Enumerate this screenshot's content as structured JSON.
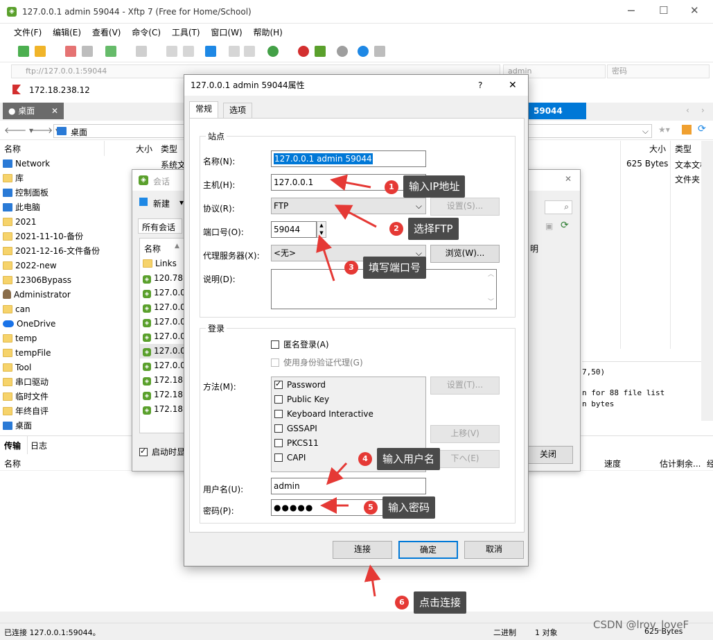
{
  "window": {
    "title": "127.0.0.1 admin 59044 - Xftp 7 (Free for Home/School)"
  },
  "menu": [
    "文件(F)",
    "编辑(E)",
    "查看(V)",
    "命令(C)",
    "工具(T)",
    "窗口(W)",
    "帮助(H)"
  ],
  "address": {
    "url": "ftp://127.0.0.1:59044",
    "user_placeholder": "admin",
    "pass_placeholder": "密码",
    "host": "172.18.238.12"
  },
  "tabs": {
    "left": "桌面",
    "right": "59044"
  },
  "nav": {
    "path": "桌面"
  },
  "left_pane": {
    "headers": {
      "name": "名称",
      "size": "大小",
      "type": "类型"
    },
    "first_type": "系统文",
    "items": [
      "Network",
      "库",
      "控制面板",
      "此电脑",
      "2021",
      "2021-11-10-备份",
      "2021-12-16-文件备份",
      "2022-new",
      "12306Bypass",
      "Administrator",
      "can",
      "OneDrive",
      "temp",
      "tempFile",
      "Tool",
      "串口驱动",
      "临时文件",
      "年终自评",
      "桌面"
    ]
  },
  "right_pane": {
    "headers": {
      "size": "大小",
      "type": "类型"
    },
    "row1": {
      "size": "625 Bytes",
      "type": "文本文档"
    },
    "row2": {
      "type": "文件夹"
    },
    "log": [
      "7,50)",
      "n for  88 file list",
      "n bytes"
    ],
    "col_partial": "明"
  },
  "transfer": {
    "tabs": [
      "传输",
      "日志"
    ],
    "headers": {
      "name": "名称",
      "speed": "速度",
      "eta": "估计剩余...",
      "last": "经"
    }
  },
  "status": {
    "left": "已连接 127.0.0.1:59044。",
    "mode": "二进制",
    "objects": "1 对象",
    "size": "625 Bytes",
    "watermark": "CSDN @lrov_loveF"
  },
  "session": {
    "title": "会话",
    "new_btn": "新建",
    "all_sessions": "所有会话",
    "col_name": "名称",
    "items": [
      "Links",
      "120.78.",
      "127.0.0",
      "127.0.0",
      "127.0.0",
      "127.0.0",
      "127.0.0",
      "127.0.0",
      "172.18.",
      "172.18.",
      "172.18."
    ],
    "startup_label": "启动时显",
    "close_btn": "关闭"
  },
  "props": {
    "title": "127.0.0.1 admin 59044属性",
    "help": "?",
    "close": "✕",
    "tabs": [
      "常规",
      "选项"
    ],
    "site_group": "站点",
    "name_label": "名称(N):",
    "name_value": "127.0.0.1 admin 59044",
    "host_label": "主机(H):",
    "host_value": "127.0.0.1",
    "proto_label": "协议(R):",
    "proto_value": "FTP",
    "settings_btn": "设置(S)...",
    "port_label": "端口号(O):",
    "port_value": "59044",
    "proxy_label": "代理服务器(X):",
    "proxy_value": "<无>",
    "browse_btn": "浏览(W)...",
    "desc_label": "说明(D):",
    "login_group": "登录",
    "anon": "匿名登录(A)",
    "agent": "使用身份验证代理(G)",
    "method_label": "方法(M):",
    "methods": [
      "Password",
      "Public Key",
      "Keyboard Interactive",
      "GSSAPI",
      "PKCS11",
      "CAPI"
    ],
    "method_settings": "设置(T)...",
    "up_btn": "上移(V)",
    "down_btn": "下へ(E)",
    "user_label": "用户名(U):",
    "user_value": "admin",
    "pass_label": "密码(P):",
    "pass_value": "●●●●●",
    "connect_btn": "连接",
    "ok_btn": "确定",
    "cancel_btn": "取消"
  },
  "annotations": [
    {
      "num": "1",
      "text": "输入IP地址"
    },
    {
      "num": "2",
      "text": "选择FTP"
    },
    {
      "num": "3",
      "text": "填写端口号"
    },
    {
      "num": "4",
      "text": "输入用户名"
    },
    {
      "num": "5",
      "text": "输入密码"
    },
    {
      "num": "6",
      "text": "点击连接"
    }
  ],
  "colors": {
    "accent": "#0078d7",
    "badge": "#e53935",
    "note_bg": "#4a4a4a",
    "arrow": "#e53935"
  }
}
